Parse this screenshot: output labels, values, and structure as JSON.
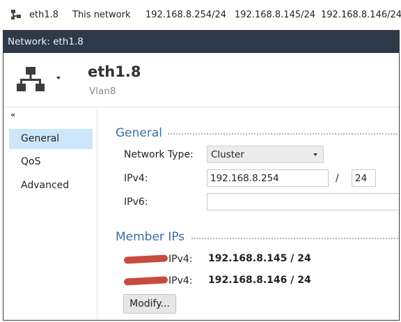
{
  "background_row": {
    "name": "eth1.8",
    "scope": "This network",
    "ips": [
      "192.168.8.254/24",
      "192.168.8.145/24",
      "192.168.8.146/24"
    ]
  },
  "window": {
    "title": "Network: eth1.8"
  },
  "header": {
    "title": "eth1.8",
    "subtitle": "Vlan8",
    "icon": "network-icon"
  },
  "sidebar": {
    "collapse": "«",
    "items": [
      {
        "label": "General",
        "active": true
      },
      {
        "label": "QoS",
        "active": false
      },
      {
        "label": "Advanced",
        "active": false
      }
    ]
  },
  "general": {
    "title": "General",
    "network_type_label": "Network Type:",
    "network_type_value": "Cluster",
    "ipv4_label": "IPv4:",
    "ipv4_value": "192.168.8.254",
    "separator": "/",
    "prefix_value": "24",
    "ipv6_label": "IPv6:",
    "ipv6_value": ""
  },
  "member_ips": {
    "title": "Member IPs",
    "items": [
      {
        "label": "IPv4:",
        "value": "192.168.8.145 / 24"
      },
      {
        "label": "IPv4:",
        "value": "192.168.8.146 / 24"
      }
    ],
    "modify_label": "Modify..."
  },
  "colors": {
    "titlebar": "#2e3a4a",
    "accent": "#3a6ea8",
    "selection": "#cde6fa",
    "redaction": "#c0392b"
  }
}
